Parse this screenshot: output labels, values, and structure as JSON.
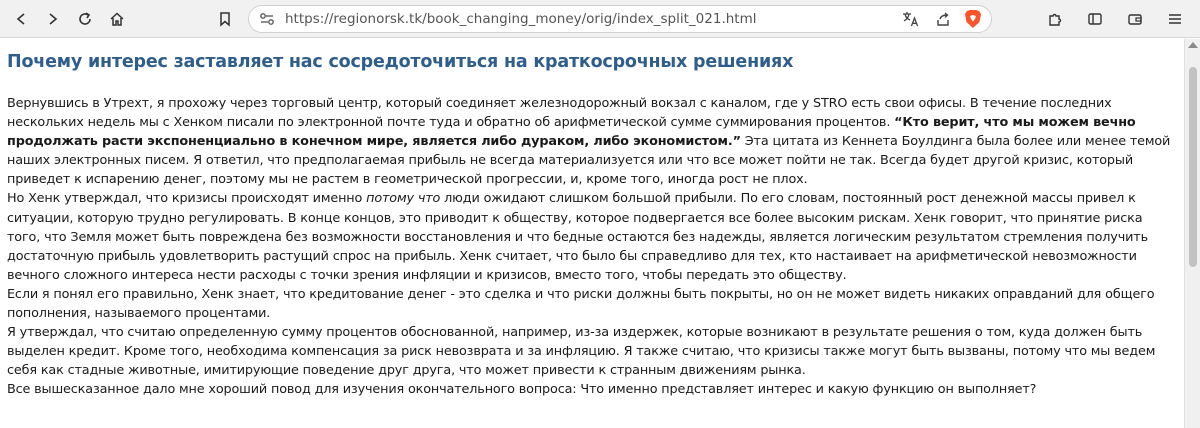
{
  "browser": {
    "url": "https://regionorsk.tk/book_changing_money/orig/index_split_021.html",
    "icons": {
      "back": "arrow-left-icon",
      "forward": "arrow-right-icon",
      "reload": "reload-icon",
      "home": "home-icon",
      "bookmark": "bookmark-icon",
      "site_info": "site-info-icon",
      "translate": "translate-icon",
      "share": "share-icon",
      "shields": "brave-shield-icon",
      "extensions": "puzzle-icon",
      "sidebar": "sidebar-icon",
      "wallet": "wallet-icon",
      "menu": "menu-icon"
    }
  },
  "article": {
    "title": "Почему интерес заставляет нас сосредоточиться на краткосрочных решениях",
    "p1_a": "Вернувшись в Утрехт, я прохожу через торговый центр, который соединяет железнодорожный вокзал с каналом, где у STRO есть свои офисы. В течение последних нескольких недель мы с Хенком писали по электронной почте туда и обратно об арифметической сумме суммирования процентов. ",
    "p1_bold": "“Кто верит, что мы можем вечно продолжать расти экспоненциально в конечном мире, является либо дураком, либо экономистом.”",
    "p1_b": " Эта цитата из Кеннета Боулдинга была более или менее темой наших электронных писем. Я ответил, что предполагаемая прибыль не всегда материализуется или что все может пойти не так. Всегда будет другой кризис, который приведет к испарению денег, поэтому мы не растем в геометрической прогрессии, и, кроме того, иногда рост не плох.",
    "p2_a": "Но Хенк утверждал, что кризисы происходят именно ",
    "p2_em": "потому что",
    "p2_b": " люди ожидают слишком большой прибыли. По его словам, постоянный рост денежной массы привел к ситуации, которую трудно регулировать. В конце концов, это приводит к обществу, которое подвергается все более высоким рискам. Хенк говорит, что принятие риска того, что Земля может быть повреждена без возможности восстановления и что бедные остаются без надежды, является логическим результатом стремления получить достаточную прибыль удовлетворить растущий спрос на прибыль. Хенк считает, что было бы справедливо для тех, кто настаивает на арифметической невозможности вечного сложного интереса нести расходы с точки зрения инфляции и кризисов, вместо того, чтобы передать это обществу.",
    "p3": "Если я понял его правильно, Хенк знает, что кредитование денег - это сделка и что риски должны быть покрыты, но он не может видеть никаких оправданий для общего пополнения, называемого процентами.",
    "p4": "Я утверждал, что считаю определенную сумму процентов обоснованной, например, из-за издержек, которые возникают в результате решения о том, куда должен быть выделен кредит. Кроме того, необходима компенсация за риск невозврата и за инфляцию. Я также считаю, что кризисы также могут быть вызваны, потому что мы ведем себя как стадные животные, имитирующие поведение друг друга, что может привести к странным движениям рынка.",
    "p5": "Все вышесказанное дало мне хороший повод для изучения окончательного вопроса: Что именно представляет интерес и какую функцию он выполняет?"
  },
  "colors": {
    "heading": "#2f5d8c",
    "text": "#1a1a1a",
    "toolbar": "#f1f1f1",
    "brave": "#fb542b"
  }
}
